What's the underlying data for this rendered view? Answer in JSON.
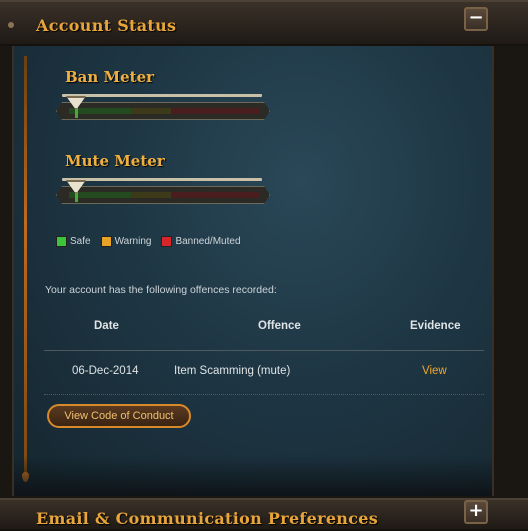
{
  "account_status": {
    "title": "Account Status",
    "toggle_symbol": "−"
  },
  "ban_meter": {
    "title": "Ban Meter",
    "level": 0
  },
  "mute_meter": {
    "title": "Mute Meter",
    "level": 0
  },
  "legend": {
    "safe": "Safe",
    "warning": "Warning",
    "banned": "Banned/Muted",
    "colors": {
      "safe": "#3ec43a",
      "warning": "#e8a225",
      "banned": "#d8252a"
    }
  },
  "offences": {
    "intro": "Your account has the following offences recorded:",
    "columns": {
      "date": "Date",
      "offence": "Offence",
      "evidence": "Evidence"
    },
    "rows": [
      {
        "date": "06-Dec-2014",
        "offence": "Item Scamming (mute)",
        "evidence": "View"
      }
    ]
  },
  "code_of_conduct_button": "View Code of Conduct",
  "email_prefs": {
    "title": "Email & Communication Preferences",
    "toggle_symbol": "+"
  }
}
